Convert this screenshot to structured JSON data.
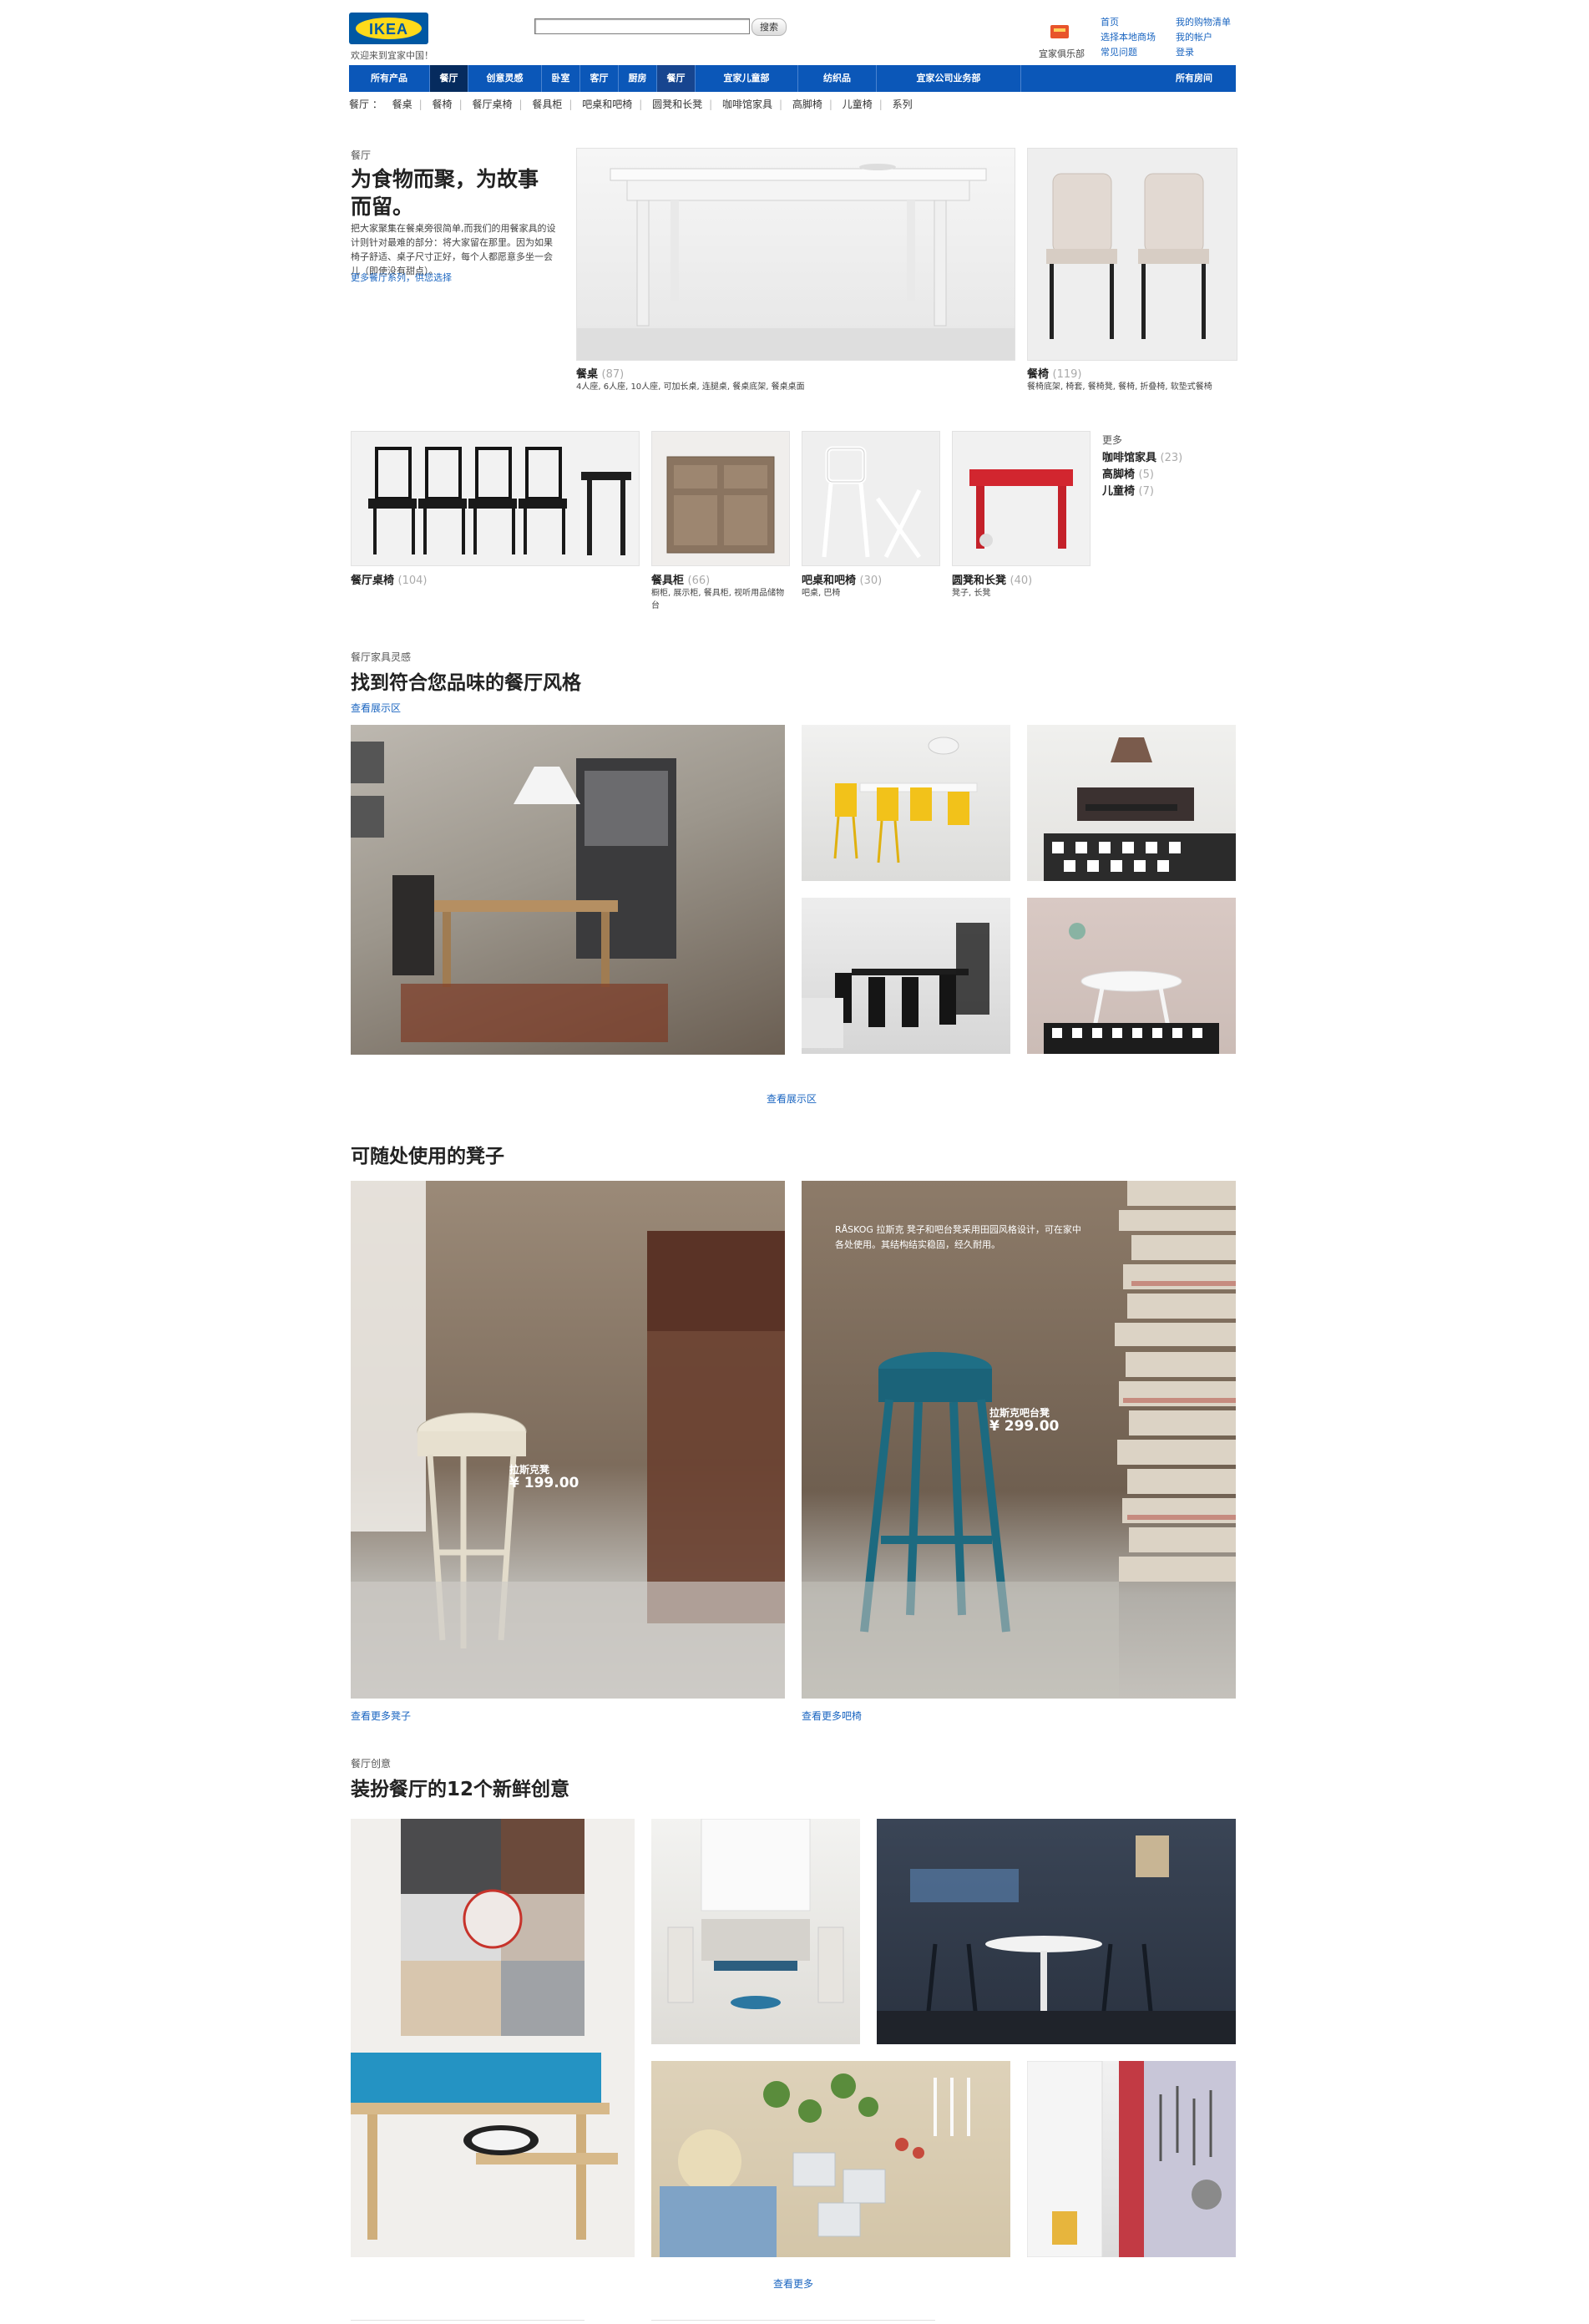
{
  "header": {
    "logo_text": "IKEA",
    "tagline": "欢迎来到宜家中国！",
    "search_placeholder": "",
    "search_button": "搜索",
    "family_label": "宜家俱乐部",
    "links_col1": [
      "首页",
      "选择本地商场",
      "常见问题"
    ],
    "links_col2": [
      "我的购物清单",
      "我的帐户",
      "登录"
    ]
  },
  "nav": {
    "items": [
      "所有产品",
      "餐厅",
      "创意灵感",
      "卧室",
      "客厅",
      "厨房",
      "餐厅",
      "宜家儿童部",
      "纺织品",
      "宜家公司业务部",
      "所有房间"
    ]
  },
  "subnav": {
    "label": "餐厅 ：",
    "items": [
      "餐桌",
      "餐椅",
      "餐厅桌椅",
      "餐具柜",
      "吧桌和吧椅",
      "圆凳和长凳",
      "咖啡馆家具",
      "高脚椅",
      "儿童椅",
      "系列"
    ]
  },
  "hero": {
    "kicker": "餐厅",
    "title": "为食物而聚，为故事而留。",
    "description": "把大家聚集在餐桌旁很简单,而我们的用餐家具的设计则针对最难的部分：将大家留在那里。因为如果椅子舒适、桌子尺寸正好，每个人都愿意多坐一会儿（即使没有甜点）。",
    "link": "更多餐厅系列，供您选择"
  },
  "products_top": [
    {
      "title": "餐桌",
      "count": "(87)",
      "subtitle": "4人座, 6人座, 10人座, 可加长桌, 连腿桌, 餐桌底架, 餐桌桌面"
    },
    {
      "title": "餐椅",
      "count": "(119)",
      "subtitle": "餐椅底架, 椅套, 餐椅凳, 餐椅, 折叠椅, 软垫式餐椅"
    }
  ],
  "products_row": [
    {
      "title": "餐厅桌椅",
      "count": "(104)",
      "subtitle": ""
    },
    {
      "title": "餐具柜",
      "count": "(66)",
      "subtitle": "橱柜, 展示柜, 餐具柜, 视听用品储物台"
    },
    {
      "title": "吧桌和吧椅",
      "count": "(30)",
      "subtitle": "吧桌, 巴椅"
    },
    {
      "title": "圆凳和长凳",
      "count": "(40)",
      "subtitle": "凳子, 长凳"
    }
  ],
  "more": {
    "label": "更多",
    "items": [
      {
        "title": "咖啡馆家具",
        "count": "(23)"
      },
      {
        "title": "高脚椅",
        "count": "(5)"
      },
      {
        "title": "儿童椅",
        "count": "(7)"
      }
    ]
  },
  "inspiration": {
    "kicker": "餐厅家具灵感",
    "title": "找到符合您品味的餐厅风格",
    "top_link": "查看展示区",
    "bottom_link": "查看展示区"
  },
  "stools": {
    "title": "可随处使用的凳子",
    "left_tag_name": "拉斯克凳",
    "left_price": "¥ 199.00",
    "right_caption": "RÅSKOG 拉斯克 凳子和吧台凳采用田园风格设计，可在家中各处使用。其结构结实稳固，经久耐用。",
    "right_tag_name": "拉斯克吧台凳",
    "right_price": "¥ 299.00",
    "left_link": "查看更多凳子",
    "right_link": "查看更多吧椅"
  },
  "ideas": {
    "kicker": "餐厅创意",
    "title": "装扮餐厅的12个新鲜创意",
    "link": "查看更多"
  },
  "colors": {
    "nav_blue": "#0b57b8",
    "nav_active": "#062b5e",
    "link_blue": "#1a65c0",
    "logo_blue": "#0058a3",
    "logo_yellow": "#ffda1a"
  }
}
